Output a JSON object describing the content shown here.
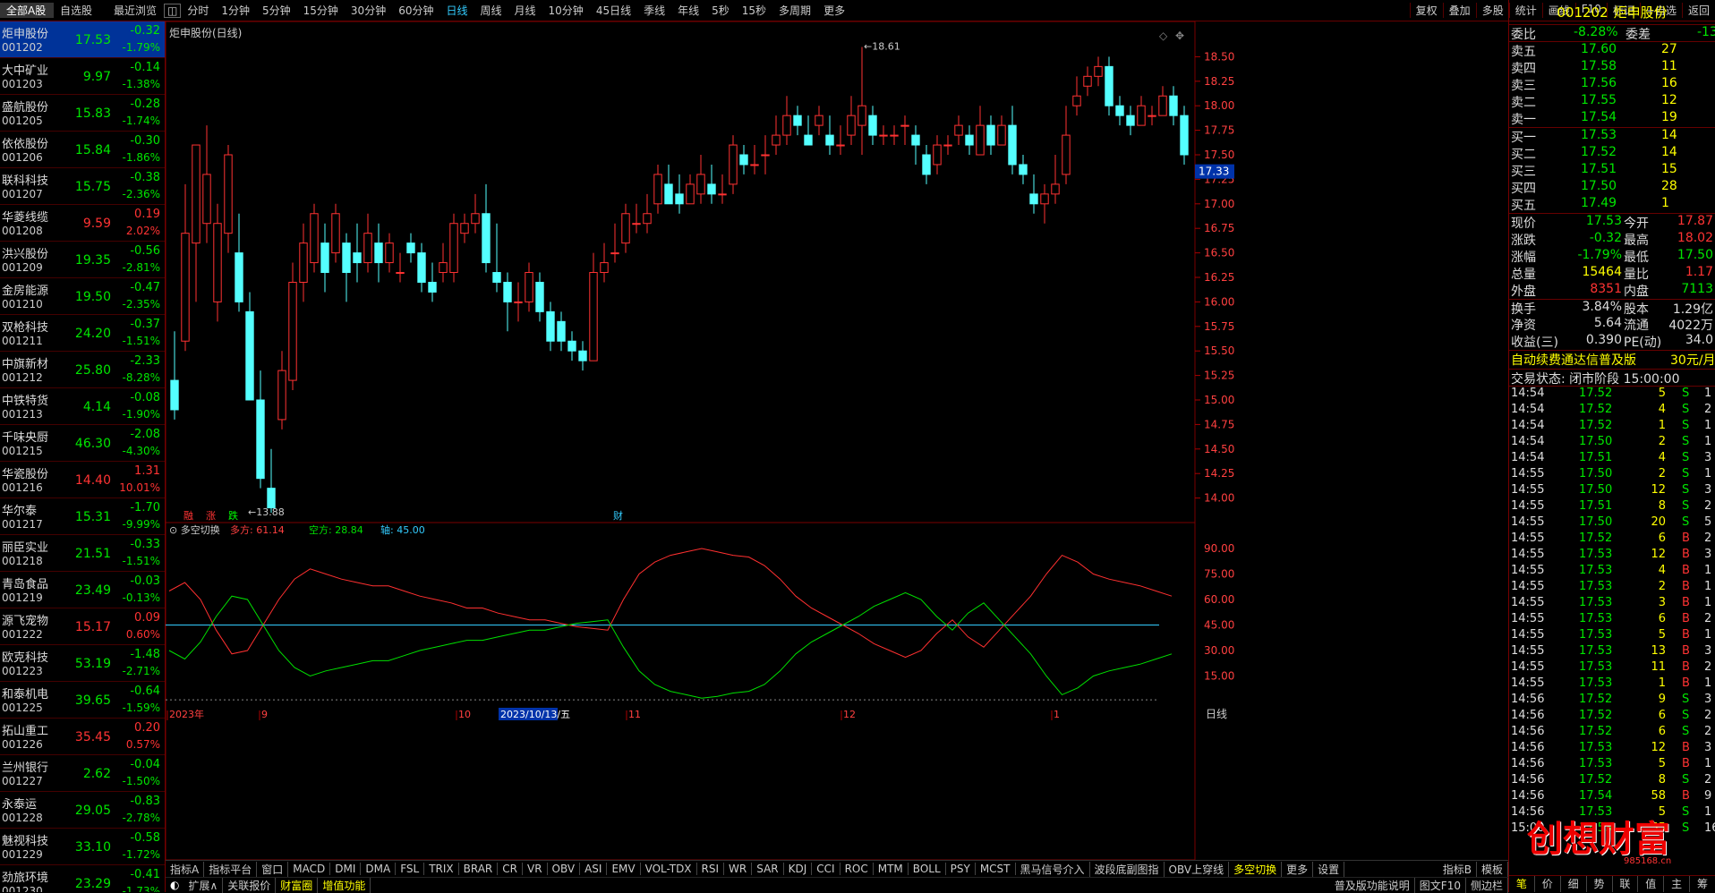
{
  "topbar": {
    "market_tab": "全部A股",
    "favorites_tab": "自选股",
    "recent_tab": "最近浏览",
    "periods": [
      "分时",
      "1分钟",
      "5分钟",
      "15分钟",
      "30分钟",
      "60分钟",
      "日线",
      "周线",
      "月线",
      "10分钟",
      "45日线",
      "季线",
      "年线",
      "5秒",
      "15秒",
      "多周期",
      "更多"
    ],
    "active_period": "日线",
    "right_buttons": [
      "复权",
      "叠加",
      "多股",
      "统计",
      "画线",
      "F10",
      "标记",
      "+自选",
      "返回"
    ]
  },
  "stocks": [
    {
      "name": "炬申股份",
      "code": "001202",
      "price": "17.53",
      "chg": "-0.32",
      "pct": "-1.79%",
      "dir": "dn",
      "selected": true
    },
    {
      "name": "大中矿业",
      "code": "001203",
      "price": "9.97",
      "chg": "-0.14",
      "pct": "-1.38%",
      "dir": "dn"
    },
    {
      "name": "盛航股份",
      "code": "001205",
      "price": "15.83",
      "chg": "-0.28",
      "pct": "-1.74%",
      "dir": "dn"
    },
    {
      "name": "依依股份",
      "code": "001206",
      "price": "15.84",
      "chg": "-0.30",
      "pct": "-1.86%",
      "dir": "dn"
    },
    {
      "name": "联科科技",
      "code": "001207",
      "price": "15.75",
      "chg": "-0.38",
      "pct": "-2.36%",
      "dir": "dn"
    },
    {
      "name": "华菱线缆",
      "code": "001208",
      "price": "9.59",
      "chg": "0.19",
      "pct": "2.02%",
      "dir": "up"
    },
    {
      "name": "洪兴股份",
      "code": "001209",
      "price": "19.35",
      "chg": "-0.56",
      "pct": "-2.81%",
      "dir": "dn"
    },
    {
      "name": "金房能源",
      "code": "001210",
      "price": "19.50",
      "chg": "-0.47",
      "pct": "-2.35%",
      "dir": "dn"
    },
    {
      "name": "双枪科技",
      "code": "001211",
      "price": "24.20",
      "chg": "-0.37",
      "pct": "-1.51%",
      "dir": "dn"
    },
    {
      "name": "中旗新材",
      "code": "001212",
      "price": "25.80",
      "chg": "-2.33",
      "pct": "-8.28%",
      "dir": "dn"
    },
    {
      "name": "中铁特货",
      "code": "001213",
      "price": "4.14",
      "chg": "-0.08",
      "pct": "-1.90%",
      "dir": "dn"
    },
    {
      "name": "千味央厨",
      "code": "001215",
      "price": "46.30",
      "chg": "-2.08",
      "pct": "-4.30%",
      "dir": "dn"
    },
    {
      "name": "华瓷股份",
      "code": "001216",
      "price": "14.40",
      "chg": "1.31",
      "pct": "10.01%",
      "dir": "up"
    },
    {
      "name": "华尔泰",
      "code": "001217",
      "price": "15.31",
      "chg": "-1.70",
      "pct": "-9.99%",
      "dir": "dn"
    },
    {
      "name": "丽臣实业",
      "code": "001218",
      "price": "21.51",
      "chg": "-0.33",
      "pct": "-1.51%",
      "dir": "dn"
    },
    {
      "name": "青岛食品",
      "code": "001219",
      "price": "23.49",
      "chg": "-0.03",
      "pct": "-0.13%",
      "dir": "dn"
    },
    {
      "name": "源飞宠物",
      "code": "001222",
      "price": "15.17",
      "chg": "0.09",
      "pct": "0.60%",
      "dir": "up"
    },
    {
      "name": "欧克科技",
      "code": "001223",
      "price": "53.19",
      "chg": "-1.48",
      "pct": "-2.71%",
      "dir": "dn"
    },
    {
      "name": "和泰机电",
      "code": "001225",
      "price": "39.65",
      "chg": "-0.64",
      "pct": "-1.59%",
      "dir": "dn"
    },
    {
      "name": "拓山重工",
      "code": "001226",
      "price": "35.45",
      "chg": "0.20",
      "pct": "0.57%",
      "dir": "up"
    },
    {
      "name": "兰州银行",
      "code": "001227",
      "price": "2.62",
      "chg": "-0.04",
      "pct": "-1.50%",
      "dir": "dn"
    },
    {
      "name": "永泰运",
      "code": "001228",
      "price": "29.05",
      "chg": "-0.83",
      "pct": "-2.78%",
      "dir": "dn"
    },
    {
      "name": "魅视科技",
      "code": "001229",
      "price": "33.10",
      "chg": "-0.58",
      "pct": "-1.72%",
      "dir": "dn"
    },
    {
      "name": "劲旅环境",
      "code": "001230",
      "price": "23.29",
      "chg": "-0.41",
      "pct": "-1.73%",
      "dir": "dn"
    }
  ],
  "chart": {
    "title": "炬申股份(日线)",
    "high_label": "18.61",
    "low_label": "13.88",
    "cursor_price": "17.33",
    "ind_title": "多空切换",
    "ind_duo": "多方: 61.14",
    "ind_kong": "空方: 28.84",
    "ind_axis": "轴: 45.00",
    "marks": [
      "融",
      "涨",
      "跌",
      "财"
    ],
    "price_ticks": [
      "18.50",
      "18.25",
      "18.00",
      "17.75",
      "17.50",
      "17.25",
      "17.00",
      "16.75",
      "16.50",
      "16.25",
      "16.00",
      "15.75",
      "15.50",
      "15.25",
      "15.00",
      "14.75",
      "14.50",
      "14.25",
      "14.00"
    ],
    "ind_ticks": [
      "90.00",
      "75.00",
      "60.00",
      "45.00",
      "30.00",
      "15.00"
    ],
    "date_labels": [
      "2023年",
      "9",
      "10",
      "11",
      "12",
      "1"
    ],
    "cursor_date": "2023/10/13/五",
    "period_label": "日线"
  },
  "chart_data": {
    "type": "candlestick",
    "ylim": [
      13.75,
      18.75
    ],
    "candles": [
      [
        15.2,
        14.9,
        15.7,
        14.8
      ],
      [
        15.6,
        16.7,
        17.2,
        15.5
      ],
      [
        16.6,
        17.6,
        17.6,
        16.0
      ],
      [
        16.8,
        17.3,
        17.8,
        16.6
      ],
      [
        16.0,
        16.8,
        17.0,
        15.8
      ],
      [
        16.7,
        17.5,
        17.6,
        16.5
      ],
      [
        16.5,
        16.0,
        16.9,
        15.9
      ],
      [
        15.9,
        15.0,
        16.1,
        15.0
      ],
      [
        15.0,
        14.2,
        15.3,
        14.1
      ],
      [
        14.1,
        13.9,
        14.5,
        13.85
      ],
      [
        14.8,
        15.3,
        15.5,
        14.7
      ],
      [
        15.2,
        16.2,
        16.4,
        15.1
      ],
      [
        16.2,
        16.6,
        16.8,
        16.0
      ],
      [
        16.4,
        16.9,
        17.0,
        16.3
      ],
      [
        16.6,
        16.3,
        16.8,
        16.1
      ],
      [
        16.5,
        16.9,
        17.0,
        16.4
      ],
      [
        16.6,
        16.3,
        16.7,
        16.0
      ],
      [
        16.5,
        16.4,
        16.8,
        16.2
      ],
      [
        16.4,
        16.7,
        16.9,
        16.3
      ],
      [
        16.6,
        16.4,
        16.8,
        16.2
      ],
      [
        16.4,
        16.6,
        16.7,
        16.3
      ],
      [
        16.3,
        16.3,
        16.5,
        16.2
      ],
      [
        16.6,
        16.5,
        16.7,
        16.4
      ],
      [
        16.5,
        16.2,
        16.6,
        16.1
      ],
      [
        16.2,
        16.1,
        16.4,
        16.0
      ],
      [
        16.3,
        16.4,
        16.6,
        16.2
      ],
      [
        16.3,
        16.8,
        16.9,
        16.2
      ],
      [
        16.7,
        16.8,
        16.9,
        16.6
      ],
      [
        16.8,
        16.9,
        17.1,
        16.7
      ],
      [
        16.9,
        16.4,
        17.2,
        16.3
      ],
      [
        16.3,
        16.2,
        16.8,
        16.1
      ],
      [
        16.2,
        16.0,
        16.3,
        15.7
      ],
      [
        16.0,
        16.0,
        16.2,
        15.8
      ],
      [
        16.0,
        16.3,
        16.4,
        15.9
      ],
      [
        16.2,
        15.9,
        16.3,
        15.8
      ],
      [
        15.9,
        15.6,
        16.0,
        15.5
      ],
      [
        15.8,
        15.6,
        15.9,
        15.5
      ],
      [
        15.6,
        15.5,
        15.7,
        15.4
      ],
      [
        15.5,
        15.4,
        15.6,
        15.3
      ],
      [
        15.4,
        16.3,
        16.5,
        15.4
      ],
      [
        16.3,
        16.4,
        16.6,
        16.2
      ],
      [
        16.5,
        16.5,
        16.8,
        16.4
      ],
      [
        16.6,
        16.9,
        17.0,
        16.5
      ],
      [
        16.8,
        16.8,
        17.0,
        16.7
      ],
      [
        16.8,
        16.9,
        17.1,
        16.7
      ],
      [
        17.0,
        17.3,
        17.4,
        16.9
      ],
      [
        17.2,
        17.0,
        17.4,
        17.0
      ],
      [
        17.1,
        17.0,
        17.3,
        16.9
      ],
      [
        17.0,
        17.2,
        17.3,
        17.0
      ],
      [
        17.1,
        17.3,
        17.5,
        17.0
      ],
      [
        17.2,
        17.1,
        17.4,
        17.0
      ],
      [
        17.1,
        17.1,
        17.3,
        17.0
      ],
      [
        17.2,
        17.6,
        17.7,
        17.1
      ],
      [
        17.5,
        17.4,
        17.6,
        17.3
      ],
      [
        17.4,
        17.4,
        17.6,
        17.3
      ],
      [
        17.5,
        17.5,
        17.7,
        17.3
      ],
      [
        17.6,
        17.7,
        17.9,
        17.5
      ],
      [
        17.7,
        17.9,
        18.1,
        17.6
      ],
      [
        17.9,
        17.8,
        18.0,
        17.7
      ],
      [
        17.7,
        17.6,
        17.9,
        17.6
      ],
      [
        17.8,
        17.9,
        18.0,
        17.7
      ],
      [
        17.7,
        17.6,
        17.9,
        17.5
      ],
      [
        17.6,
        17.6,
        17.8,
        17.5
      ],
      [
        17.7,
        17.9,
        18.1,
        17.6
      ],
      [
        17.8,
        18.0,
        18.6,
        17.5
      ],
      [
        17.9,
        17.7,
        18.0,
        17.6
      ],
      [
        17.7,
        17.7,
        17.8,
        17.6
      ],
      [
        17.7,
        17.7,
        17.8,
        17.6
      ],
      [
        17.8,
        17.8,
        17.9,
        17.6
      ],
      [
        17.7,
        17.6,
        17.8,
        17.4
      ],
      [
        17.5,
        17.3,
        17.6,
        17.2
      ],
      [
        17.4,
        17.6,
        17.7,
        17.3
      ],
      [
        17.6,
        17.6,
        17.7,
        17.5
      ],
      [
        17.7,
        17.8,
        17.9,
        17.6
      ],
      [
        17.7,
        17.6,
        17.8,
        17.5
      ],
      [
        17.5,
        17.8,
        18.0,
        17.5
      ],
      [
        17.8,
        17.6,
        17.9,
        17.5
      ],
      [
        17.6,
        17.8,
        17.9,
        17.6
      ],
      [
        17.8,
        17.4,
        18.0,
        17.3
      ],
      [
        17.4,
        17.3,
        17.5,
        17.2
      ],
      [
        17.1,
        17.0,
        17.3,
        16.9
      ],
      [
        17.0,
        17.1,
        17.2,
        16.8
      ],
      [
        17.1,
        17.2,
        17.5,
        17.0
      ],
      [
        17.3,
        17.7,
        18.0,
        17.2
      ],
      [
        18.0,
        18.1,
        18.3,
        17.9
      ],
      [
        18.2,
        18.3,
        18.4,
        18.1
      ],
      [
        18.3,
        18.4,
        18.5,
        18.2
      ],
      [
        18.4,
        18.0,
        18.5,
        17.9
      ],
      [
        18.0,
        17.9,
        18.1,
        17.8
      ],
      [
        17.9,
        17.8,
        18.0,
        17.7
      ],
      [
        17.8,
        18.0,
        18.1,
        17.8
      ],
      [
        17.9,
        17.9,
        18.0,
        17.8
      ],
      [
        17.9,
        18.1,
        18.2,
        17.9
      ],
      [
        18.1,
        17.9,
        18.2,
        17.8
      ],
      [
        17.9,
        17.5,
        18.0,
        17.4
      ]
    ],
    "duo": [
      65,
      70,
      60,
      42,
      28,
      30,
      45,
      60,
      72,
      78,
      75,
      72,
      70,
      68,
      68,
      65,
      62,
      60,
      58,
      55,
      55,
      52,
      50,
      48,
      48,
      46,
      44,
      43,
      42,
      60,
      75,
      82,
      86,
      88,
      90,
      88,
      86,
      85,
      80,
      72,
      62,
      55,
      50,
      45,
      40,
      34,
      30,
      26,
      30,
      40,
      48,
      38,
      32,
      42,
      52,
      62,
      75,
      86,
      82,
      75,
      72,
      70,
      68,
      65,
      62
    ],
    "kong": [
      30,
      25,
      35,
      50,
      62,
      60,
      45,
      30,
      20,
      15,
      18,
      20,
      22,
      24,
      24,
      27,
      30,
      32,
      34,
      36,
      36,
      38,
      40,
      42,
      42,
      44,
      46,
      47,
      48,
      32,
      18,
      10,
      6,
      4,
      2,
      3,
      5,
      6,
      10,
      18,
      28,
      35,
      40,
      45,
      50,
      56,
      60,
      64,
      60,
      50,
      42,
      52,
      58,
      48,
      38,
      28,
      15,
      4,
      8,
      15,
      18,
      20,
      22,
      25,
      28
    ]
  },
  "quote": {
    "code": "001202",
    "name": "炬申股份",
    "weibi_label": "委比",
    "weibi": "-8.28%",
    "weicha_label": "委差",
    "weicha": "-13",
    "sells": [
      {
        "l": "卖五",
        "p": "17.60",
        "v": "27"
      },
      {
        "l": "卖四",
        "p": "17.58",
        "v": "11"
      },
      {
        "l": "卖三",
        "p": "17.56",
        "v": "16"
      },
      {
        "l": "卖二",
        "p": "17.55",
        "v": "12"
      },
      {
        "l": "卖一",
        "p": "17.54",
        "v": "19"
      }
    ],
    "buys": [
      {
        "l": "买一",
        "p": "17.53",
        "v": "14"
      },
      {
        "l": "买二",
        "p": "17.52",
        "v": "14"
      },
      {
        "l": "买三",
        "p": "17.51",
        "v": "15"
      },
      {
        "l": "买四",
        "p": "17.50",
        "v": "28"
      },
      {
        "l": "买五",
        "p": "17.49",
        "v": "1"
      }
    ],
    "stats": [
      [
        "现价",
        "17.53",
        "今开",
        "17.87"
      ],
      [
        "涨跌",
        "-0.32",
        "最高",
        "18.02"
      ],
      [
        "涨幅",
        "-1.79%",
        "最低",
        "17.50"
      ],
      [
        "总量",
        "15464",
        "量比",
        "1.17"
      ],
      [
        "外盘",
        "8351",
        "内盘",
        "7113"
      ],
      [
        "换手",
        "3.84%",
        "股本",
        "1.29亿"
      ],
      [
        "净资",
        "5.64",
        "流通",
        "4022万"
      ],
      [
        "收益(三)",
        "0.390",
        "PE(动)",
        "34.0"
      ]
    ],
    "ad_text": "自动续费通达信普及版",
    "ad_price": "30元/月",
    "trade_state": "交易状态: 闭市阶段 15:00:00",
    "ticks": [
      [
        "14:54",
        "17.52",
        "5",
        "S",
        "1"
      ],
      [
        "14:54",
        "17.52",
        "4",
        "S",
        "2"
      ],
      [
        "14:54",
        "17.52",
        "1",
        "S",
        "1"
      ],
      [
        "14:54",
        "17.50",
        "2",
        "S",
        "1"
      ],
      [
        "14:54",
        "17.51",
        "4",
        "S",
        "3"
      ],
      [
        "14:55",
        "17.50",
        "2",
        "S",
        "1"
      ],
      [
        "14:55",
        "17.50",
        "12",
        "S",
        "3"
      ],
      [
        "14:55",
        "17.51",
        "8",
        "S",
        "2"
      ],
      [
        "14:55",
        "17.50",
        "20",
        "S",
        "5"
      ],
      [
        "14:55",
        "17.52",
        "6",
        "B",
        "2"
      ],
      [
        "14:55",
        "17.53",
        "12",
        "B",
        "3"
      ],
      [
        "14:55",
        "17.53",
        "4",
        "B",
        "1"
      ],
      [
        "14:55",
        "17.53",
        "2",
        "B",
        "1"
      ],
      [
        "14:55",
        "17.53",
        "3",
        "B",
        "1"
      ],
      [
        "14:55",
        "17.53",
        "6",
        "B",
        "2"
      ],
      [
        "14:55",
        "17.53",
        "5",
        "B",
        "1"
      ],
      [
        "14:55",
        "17.53",
        "13",
        "B",
        "3"
      ],
      [
        "14:55",
        "17.53",
        "11",
        "B",
        "2"
      ],
      [
        "14:55",
        "17.53",
        "1",
        "B",
        "1"
      ],
      [
        "14:56",
        "17.52",
        "9",
        "S",
        "3"
      ],
      [
        "14:56",
        "17.52",
        "6",
        "S",
        "2"
      ],
      [
        "14:56",
        "17.52",
        "6",
        "S",
        "2"
      ],
      [
        "14:56",
        "17.53",
        "12",
        "B",
        "3"
      ],
      [
        "14:56",
        "17.53",
        "5",
        "B",
        "1"
      ],
      [
        "14:56",
        "17.52",
        "8",
        "S",
        "2"
      ],
      [
        "14:56",
        "17.54",
        "58",
        "B",
        "9"
      ],
      [
        "14:56",
        "17.53",
        "5",
        "S",
        "1"
      ],
      [
        "15:00",
        "17.53",
        "55",
        "S",
        "16"
      ]
    ],
    "bottom_tabs": [
      "笔",
      "价",
      "细",
      "势",
      "联",
      "值",
      "主",
      "筹"
    ],
    "watermark": "创想财富",
    "watermark_url": "985168.cn"
  },
  "bottom": {
    "ind_tabs": [
      "指标A",
      "指标平台",
      "窗口",
      "MACD",
      "DMI",
      "DMA",
      "FSL",
      "TRIX",
      "BRAR",
      "CR",
      "VR",
      "OBV",
      "ASI",
      "EMV",
      "VOL-TDX",
      "RSI",
      "WR",
      "SAR",
      "KDJ",
      "CCI",
      "ROC",
      "MTM",
      "BOLL",
      "PSY",
      "MCST",
      "黑马信号介入",
      "波段底副图指",
      "OBV上穿线",
      "多空切换",
      "更多",
      "设置"
    ],
    "active_ind": "多空切换",
    "right_tabs": [
      "指标B",
      "模板"
    ],
    "row2": [
      "扩展∧",
      "关联报价",
      "财富圈",
      "增值功能"
    ],
    "row2_right": [
      "普及版功能说明",
      "图文F10",
      "侧边栏"
    ]
  }
}
